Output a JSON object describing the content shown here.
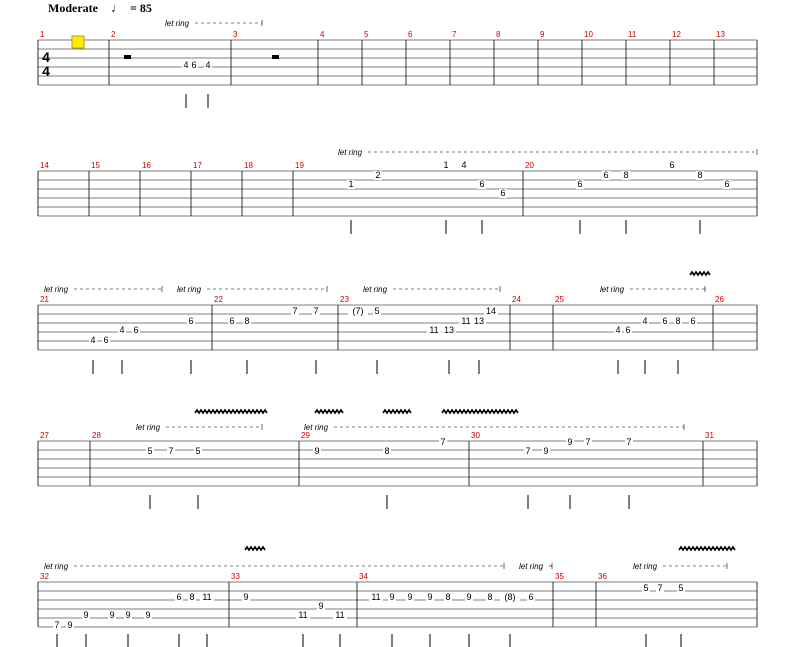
{
  "tempo": {
    "marking": "Moderate",
    "bpm_text": "= 85",
    "note_glyph": "quarter-note"
  },
  "time_signature": {
    "top": "4",
    "bottom": "4"
  },
  "systems": [
    {
      "measures": [
        "1",
        "2",
        "3",
        "4",
        "5",
        "6",
        "7",
        "8",
        "9",
        "10",
        "11",
        "12",
        "13"
      ],
      "let_ring": [
        "let ring"
      ],
      "frets": [
        "4",
        "6",
        "4"
      ]
    },
    {
      "measures": [
        "14",
        "15",
        "16",
        "17",
        "18",
        "19",
        "20"
      ],
      "let_ring": [
        "let ring"
      ],
      "frets": [
        "1",
        "2",
        "1",
        "4",
        "6",
        "6",
        "6",
        "6",
        "8",
        "6",
        "8",
        "6"
      ]
    },
    {
      "measures": [
        "21",
        "22",
        "23",
        "24",
        "25",
        "26"
      ],
      "let_ring": [
        "let ring",
        "let ring",
        "let ring",
        "let ring"
      ],
      "frets": [
        "4",
        "6",
        "4",
        "6",
        "6",
        "6",
        "8",
        "7",
        "7",
        "(7)",
        "5",
        "11",
        "13",
        "11",
        "13",
        "14",
        "4",
        "6",
        "4",
        "6",
        "8",
        "6"
      ]
    },
    {
      "measures": [
        "27",
        "28",
        "29",
        "30",
        "31"
      ],
      "let_ring": [
        "let ring",
        "let ring"
      ],
      "frets": [
        "5",
        "7",
        "5",
        "9",
        "8",
        "7",
        "7",
        "9",
        "9",
        "7",
        "7"
      ]
    },
    {
      "measures": [
        "32",
        "33",
        "34",
        "35",
        "36"
      ],
      "let_ring": [
        "let ring",
        "let ring",
        "let ring"
      ],
      "frets": [
        "7",
        "9",
        "9",
        "9",
        "9",
        "9",
        "6",
        "8",
        "11",
        "9",
        "11",
        "9",
        "11",
        "11",
        "9",
        "9",
        "9",
        "8",
        "9",
        "8",
        "(8)",
        "6",
        "5",
        "7",
        "5"
      ]
    }
  ],
  "colors": {
    "measure_number": "#cc0000",
    "staff": "#000000",
    "cursor": "#ffee00",
    "cursor_border": "#cc9900"
  }
}
